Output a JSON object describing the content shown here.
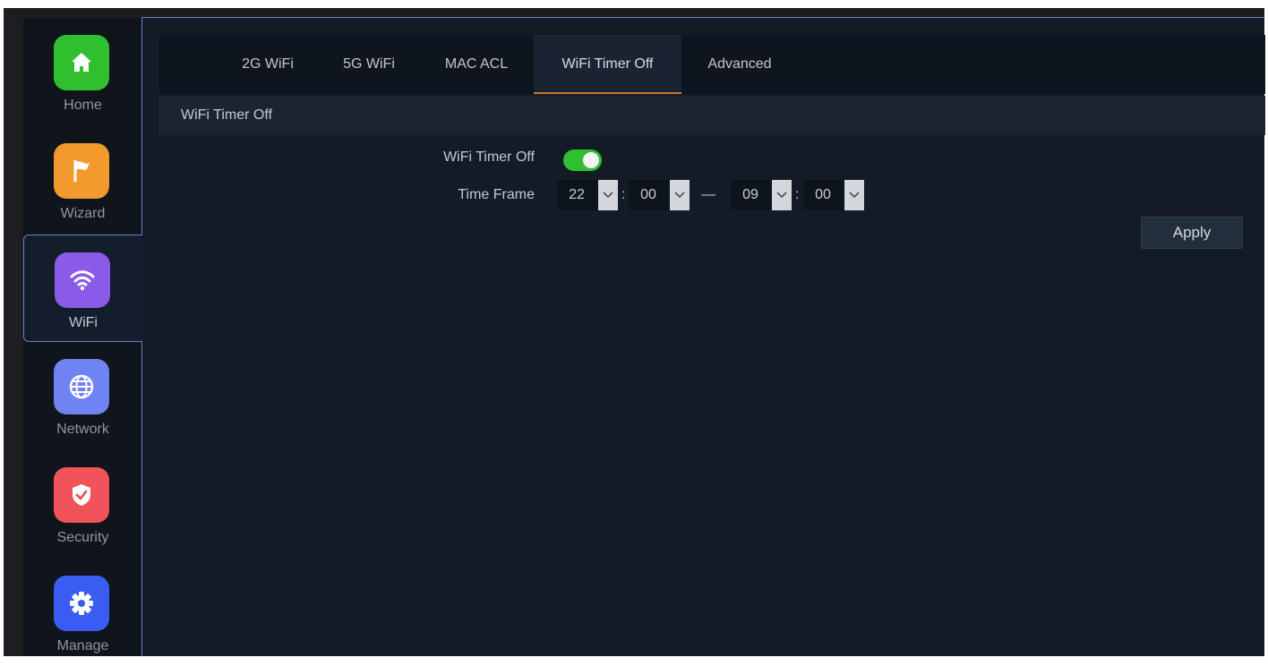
{
  "sidebar": {
    "items": [
      {
        "label": "Home",
        "icon": "home-icon",
        "color": "#2fbf2f"
      },
      {
        "label": "Wizard",
        "icon": "flag-icon",
        "color": "#f29a2e"
      },
      {
        "label": "WiFi",
        "icon": "wifi-icon",
        "color": "#8a5ae8"
      },
      {
        "label": "Network",
        "icon": "globe-icon",
        "color": "#6f84f2"
      },
      {
        "label": "Security",
        "icon": "shield-icon",
        "color": "#f0545a"
      },
      {
        "label": "Manage",
        "icon": "gear-icon",
        "color": "#3a5cf2"
      }
    ],
    "active_item": "WiFi"
  },
  "tabs": [
    {
      "label": "2G WiFi"
    },
    {
      "label": "5G WiFi"
    },
    {
      "label": "MAC ACL"
    },
    {
      "label": "WiFi Timer Off"
    },
    {
      "label": "Advanced"
    }
  ],
  "active_tab": "WiFi Timer Off",
  "section_title": "WiFi Timer Off",
  "form": {
    "timer_label": "WiFi Timer Off",
    "timer_enabled": true,
    "time_frame_label": "Time Frame",
    "start_hour": "22",
    "start_minute": "00",
    "end_hour": "09",
    "end_minute": "00",
    "colon": ":",
    "range_separator": "—"
  },
  "apply_label": "Apply",
  "colors": {
    "accent_tab_underline": "#c8762e",
    "toggle_on": "#2fbf2f",
    "active_border": "#6f7fd0"
  }
}
